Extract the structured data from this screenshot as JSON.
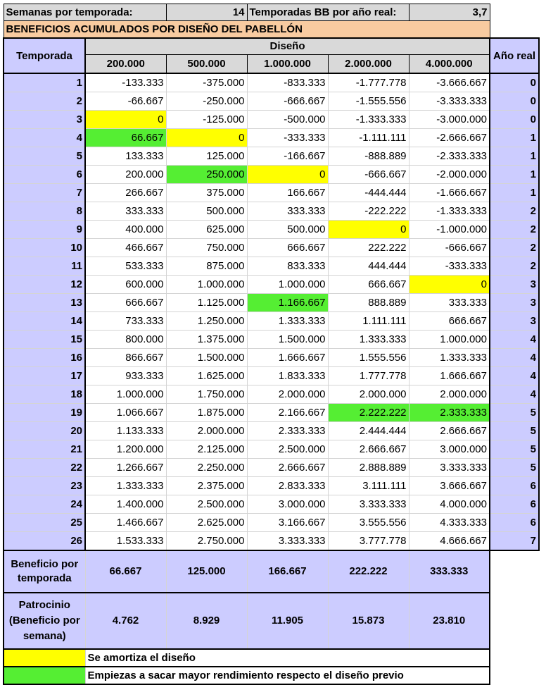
{
  "header": {
    "semanas_label": "Semanas por temporada:",
    "semanas_value": "14",
    "temporadas_label": "Temporadas BB por año real:",
    "temporadas_value": "3,7"
  },
  "title": "BENEFICIOS ACUMULADOS POR DISEÑO DEL PABELLÓN",
  "columns": {
    "temporada": "Temporada",
    "diseno": "Diseño",
    "anio_real": "Año real",
    "designs": [
      "200.000",
      "500.000",
      "1.000.000",
      "2.000.000",
      "4.000.000"
    ]
  },
  "rows": [
    {
      "t": "1",
      "v": [
        "-133.333",
        "-375.000",
        "-833.333",
        "-1.777.778",
        "-3.666.667"
      ],
      "a": "0"
    },
    {
      "t": "2",
      "v": [
        "-66.667",
        "-250.000",
        "-666.667",
        "-1.555.556",
        "-3.333.333"
      ],
      "a": "0"
    },
    {
      "t": "3",
      "v": [
        "0",
        "-125.000",
        "-500.000",
        "-1.333.333",
        "-3.000.000"
      ],
      "a": "0"
    },
    {
      "t": "4",
      "v": [
        "66.667",
        "0",
        "-333.333",
        "-1.111.111",
        "-2.666.667"
      ],
      "a": "1"
    },
    {
      "t": "5",
      "v": [
        "133.333",
        "125.000",
        "-166.667",
        "-888.889",
        "-2.333.333"
      ],
      "a": "1"
    },
    {
      "t": "6",
      "v": [
        "200.000",
        "250.000",
        "0",
        "-666.667",
        "-2.000.000"
      ],
      "a": "1"
    },
    {
      "t": "7",
      "v": [
        "266.667",
        "375.000",
        "166.667",
        "-444.444",
        "-1.666.667"
      ],
      "a": "1"
    },
    {
      "t": "8",
      "v": [
        "333.333",
        "500.000",
        "333.333",
        "-222.222",
        "-1.333.333"
      ],
      "a": "2"
    },
    {
      "t": "9",
      "v": [
        "400.000",
        "625.000",
        "500.000",
        "0",
        "-1.000.000"
      ],
      "a": "2"
    },
    {
      "t": "10",
      "v": [
        "466.667",
        "750.000",
        "666.667",
        "222.222",
        "-666.667"
      ],
      "a": "2"
    },
    {
      "t": "11",
      "v": [
        "533.333",
        "875.000",
        "833.333",
        "444.444",
        "-333.333"
      ],
      "a": "2"
    },
    {
      "t": "12",
      "v": [
        "600.000",
        "1.000.000",
        "1.000.000",
        "666.667",
        "0"
      ],
      "a": "3"
    },
    {
      "t": "13",
      "v": [
        "666.667",
        "1.125.000",
        "1.166.667",
        "888.889",
        "333.333"
      ],
      "a": "3"
    },
    {
      "t": "14",
      "v": [
        "733.333",
        "1.250.000",
        "1.333.333",
        "1.111.111",
        "666.667"
      ],
      "a": "3"
    },
    {
      "t": "15",
      "v": [
        "800.000",
        "1.375.000",
        "1.500.000",
        "1.333.333",
        "1.000.000"
      ],
      "a": "4"
    },
    {
      "t": "16",
      "v": [
        "866.667",
        "1.500.000",
        "1.666.667",
        "1.555.556",
        "1.333.333"
      ],
      "a": "4"
    },
    {
      "t": "17",
      "v": [
        "933.333",
        "1.625.000",
        "1.833.333",
        "1.777.778",
        "1.666.667"
      ],
      "a": "4"
    },
    {
      "t": "18",
      "v": [
        "1.000.000",
        "1.750.000",
        "2.000.000",
        "2.000.000",
        "2.000.000"
      ],
      "a": "4"
    },
    {
      "t": "19",
      "v": [
        "1.066.667",
        "1.875.000",
        "2.166.667",
        "2.222.222",
        "2.333.333"
      ],
      "a": "5"
    },
    {
      "t": "20",
      "v": [
        "1.133.333",
        "2.000.000",
        "2.333.333",
        "2.444.444",
        "2.666.667"
      ],
      "a": "5"
    },
    {
      "t": "21",
      "v": [
        "1.200.000",
        "2.125.000",
        "2.500.000",
        "2.666.667",
        "3.000.000"
      ],
      "a": "5"
    },
    {
      "t": "22",
      "v": [
        "1.266.667",
        "2.250.000",
        "2.666.667",
        "2.888.889",
        "3.333.333"
      ],
      "a": "5"
    },
    {
      "t": "23",
      "v": [
        "1.333.333",
        "2.375.000",
        "2.833.333",
        "3.111.111",
        "3.666.667"
      ],
      "a": "6"
    },
    {
      "t": "24",
      "v": [
        "1.400.000",
        "2.500.000",
        "3.000.000",
        "3.333.333",
        "4.000.000"
      ],
      "a": "6"
    },
    {
      "t": "25",
      "v": [
        "1.466.667",
        "2.625.000",
        "3.166.667",
        "3.555.556",
        "4.333.333"
      ],
      "a": "6"
    },
    {
      "t": "26",
      "v": [
        "1.533.333",
        "2.750.000",
        "3.333.333",
        "3.777.778",
        "4.666.667"
      ],
      "a": "7"
    }
  ],
  "highlights": {
    "yellow": [
      [
        2,
        0
      ],
      [
        3,
        1
      ],
      [
        5,
        2
      ],
      [
        8,
        3
      ],
      [
        11,
        4
      ]
    ],
    "green": [
      [
        3,
        0
      ],
      [
        5,
        1
      ],
      [
        12,
        2
      ],
      [
        18,
        3
      ],
      [
        18,
        4
      ]
    ]
  },
  "summary": {
    "beneficio_label": "Beneficio por temporada",
    "beneficio_values": [
      "66.667",
      "125.000",
      "166.667",
      "222.222",
      "333.333"
    ],
    "patrocinio_label": "Patrocinio (Beneficio por semana)",
    "patrocinio_values": [
      "4.762",
      "8.929",
      "11.905",
      "15.873",
      "23.810"
    ]
  },
  "legend": {
    "yellow_text": "Se amortiza el diseño",
    "green_text": "Empiezas a sacar mayor rendimiento respecto el diseño previo"
  },
  "colors": {
    "yellow": "#ffff00",
    "green": "#55ee33",
    "lavender": "#ccccff",
    "orange": "#f8cba0",
    "gray": "#d9d9d9"
  }
}
